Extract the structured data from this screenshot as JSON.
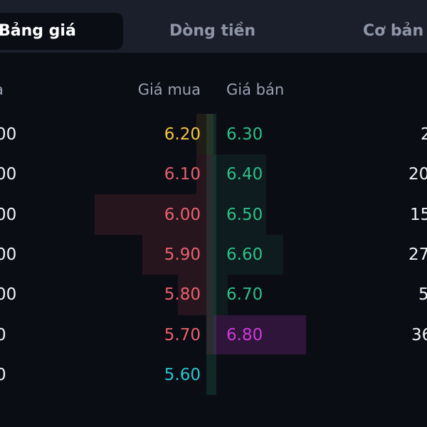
{
  "tabs": [
    {
      "label": "Bảng giá",
      "active": true
    },
    {
      "label": "Dòng tiền",
      "active": false
    },
    {
      "label": "Cơ bản",
      "active": false
    }
  ],
  "table": {
    "headers": {
      "buy_volume": "a",
      "buy_price": "Giá mua",
      "sell_price": "Giá bán"
    },
    "rows": [
      {
        "buy_volume": "00",
        "buy_price": "6.20",
        "sell_price": "6.30",
        "sell_volume": "2"
      },
      {
        "buy_volume": "00",
        "buy_price": "6.10",
        "sell_price": "6.40",
        "sell_volume": "20"
      },
      {
        "buy_volume": "00",
        "buy_price": "6.00",
        "sell_price": "6.50",
        "sell_volume": "15"
      },
      {
        "buy_volume": "00",
        "buy_price": "5.90",
        "sell_price": "6.60",
        "sell_volume": "27"
      },
      {
        "buy_volume": "00",
        "buy_price": "5.80",
        "sell_price": "6.70",
        "sell_volume": "5"
      },
      {
        "buy_volume": "0",
        "buy_price": "5.70",
        "sell_price": "6.80",
        "sell_volume": "36"
      },
      {
        "buy_volume": "0",
        "buy_price": "5.60",
        "sell_price": "",
        "sell_volume": ""
      }
    ]
  },
  "colors": {
    "background": "#0b0d15",
    "tabbar": "#1b1f2b",
    "price_ceiling_like": "#cf3ad9",
    "price_floor_like": "#2bc4cf",
    "price_reference_like": "#f5c542",
    "price_down": "#e8616d",
    "price_up": "#2fbf86"
  }
}
